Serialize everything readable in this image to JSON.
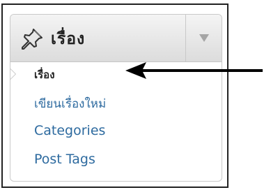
{
  "menu": {
    "header": {
      "title": "เรื่อง",
      "icon": "pushpin-icon",
      "toggle_icon": "chevron-down-icon"
    },
    "items": [
      {
        "label": "เรื่อง",
        "current": true
      },
      {
        "label": "เขียนเรื่องใหม่",
        "current": false
      },
      {
        "label": "Categories",
        "current": false
      },
      {
        "label": "Post Tags",
        "current": false
      }
    ]
  },
  "annotation": {
    "icon": "arrow-left-icon",
    "color": "#000000"
  },
  "colors": {
    "link": "#2d6a9f",
    "current_text": "#222222",
    "header_top": "#f4f4f4",
    "header_bottom": "#dcdcdc",
    "border": "#c9c9c9"
  }
}
